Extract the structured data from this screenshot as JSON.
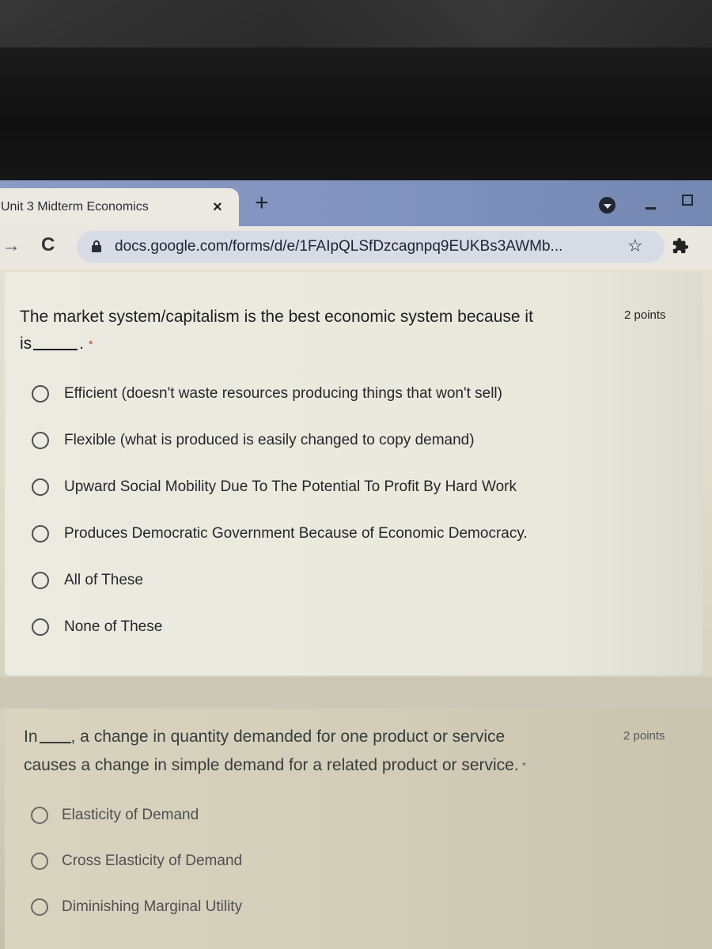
{
  "browser": {
    "tab": {
      "title": "Unit 3 Midterm Economics",
      "close_icon": "×"
    },
    "new_tab_icon": "+",
    "url": "docs.google.com/forms/d/e/1FAIpQLSfDzcagnpq9EUKBs3AWMb...",
    "icons": {
      "forward": "→",
      "reload": "C",
      "star": "☆"
    }
  },
  "form": {
    "questions": [
      {
        "title_line1": "The market system/capitalism is the best economic system because it",
        "title_line2_prefix": "is",
        "title_suffix": ".",
        "required_mark": "*",
        "points": "2 points",
        "options": [
          "Efficient (doesn't waste resources producing things that won't sell)",
          "Flexible (what is produced is easily changed to copy demand)",
          "Upward Social Mobility Due To The Potential To Profit By Hard Work",
          "Produces Democratic Government Because of Economic Democracy.",
          "All of These",
          "None of These"
        ]
      },
      {
        "title_prefix": "In",
        "title_rest": ", a change in quantity demanded for one product or service",
        "title_line2": "causes a change in simple demand for a related product or service.",
        "required_mark": "*",
        "points": "2 points",
        "options": [
          "Elasticity of Demand",
          "Cross Elasticity of Demand",
          "Diminishing Marginal Utility"
        ]
      }
    ]
  }
}
